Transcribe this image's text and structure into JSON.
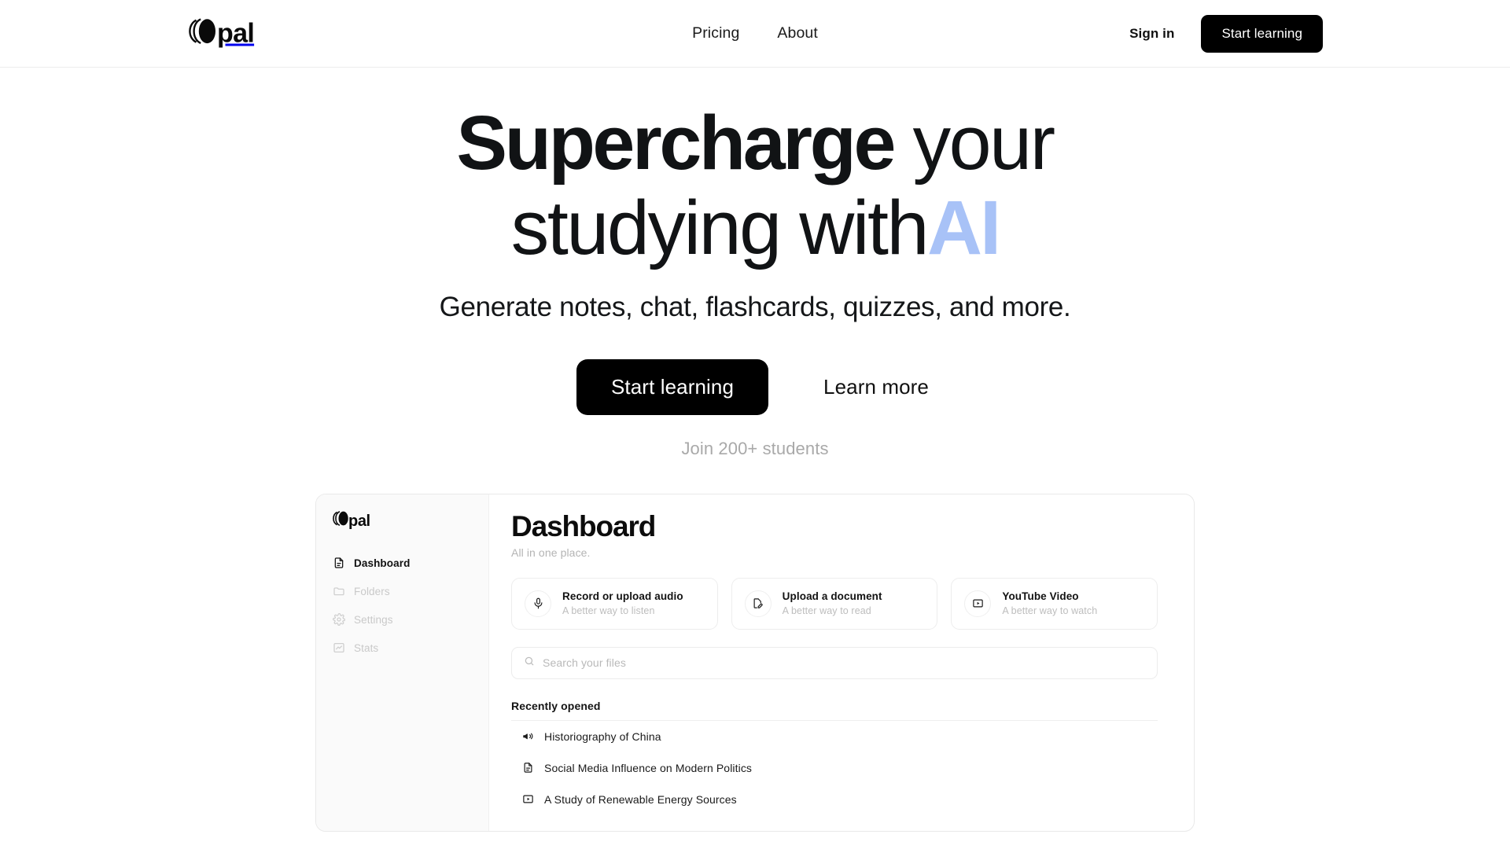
{
  "header": {
    "brand": {
      "word": "pal",
      "mark_icon": "opal-logo-icon"
    },
    "nav": [
      {
        "label": "Pricing"
      },
      {
        "label": "About"
      }
    ],
    "signin_label": "Sign in",
    "cta_label": "Start learning"
  },
  "hero": {
    "title_part1": "Supercharge",
    "title_part2": " your studying with",
    "title_accent": "AI",
    "subtitle": "Generate notes, chat, flashcards, quizzes, and more.",
    "primary_cta": "Start learning",
    "secondary_cta": "Learn more",
    "social_proof": "Join 200+ students",
    "accent_color": "#a8c2f7"
  },
  "dashboard_preview": {
    "brand": {
      "word": "pal",
      "mark_icon": "opal-logo-icon"
    },
    "sidebar_items": [
      {
        "label": "Dashboard",
        "icon": "document-icon",
        "active": true
      },
      {
        "label": "Folders",
        "icon": "folder-icon",
        "active": false
      },
      {
        "label": "Settings",
        "icon": "gear-icon",
        "active": false
      },
      {
        "label": "Stats",
        "icon": "chart-icon",
        "active": false
      }
    ],
    "title": "Dashboard",
    "subtitle": "All in one place.",
    "cards": [
      {
        "title": "Record or upload audio",
        "desc": "A better way to listen",
        "icon": "microphone-icon"
      },
      {
        "title": "Upload a document",
        "desc": "A better way to read",
        "icon": "document-edit-icon"
      },
      {
        "title": "YouTube Video",
        "desc": "A better way to watch",
        "icon": "video-play-icon"
      }
    ],
    "search": {
      "placeholder": "Search your files",
      "value": "",
      "icon": "search-icon"
    },
    "recent_heading": "Recently opened",
    "recent_items": [
      {
        "label": "Historiography of China",
        "icon": "audio-speaker-icon"
      },
      {
        "label": "Social Media Influence on Modern Politics",
        "icon": "document-icon"
      },
      {
        "label": "A Study of Renewable Energy Sources",
        "icon": "video-play-icon"
      }
    ]
  }
}
